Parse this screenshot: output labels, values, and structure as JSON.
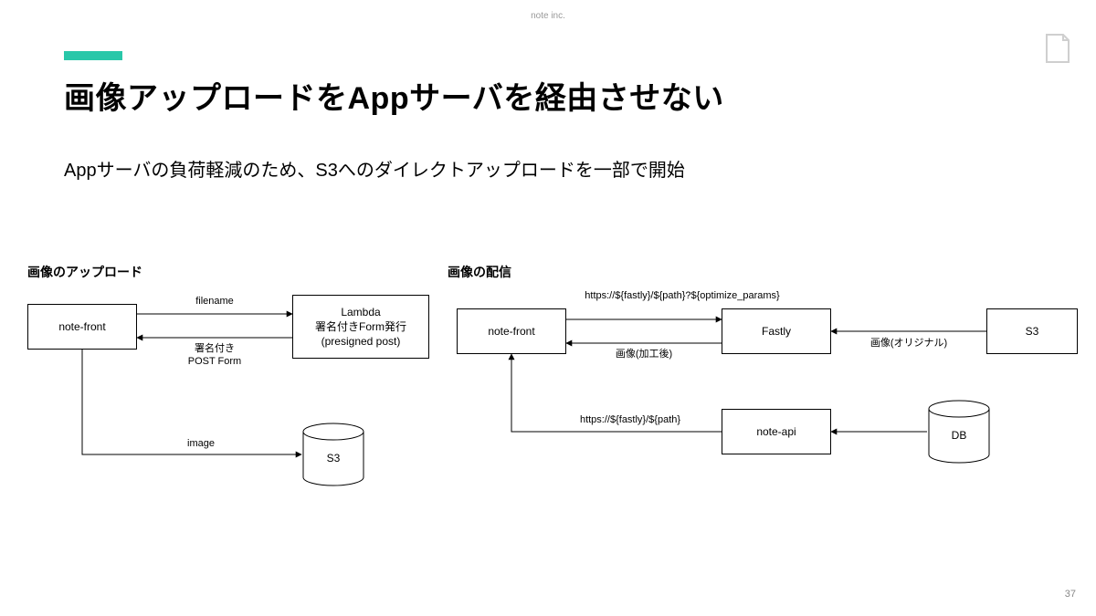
{
  "company": "note inc.",
  "title": "画像アップロードをAppサーバを経由させない",
  "subtitle": "Appサーバの負荷軽減のため、S3へのダイレクトアップロードを一部で開始",
  "page_number": "37",
  "diagrams": {
    "upload": {
      "title": "画像のアップロード",
      "nodes": {
        "note_front": "note-front",
        "lambda": "Lambda\n署名付きForm発行\n(presigned post)",
        "s3": "S3"
      },
      "edges": {
        "filename": "filename",
        "signed_form": "署名付き\nPOST Form",
        "image": "image"
      }
    },
    "delivery": {
      "title": "画像の配信",
      "nodes": {
        "note_front": "note-front",
        "fastly": "Fastly",
        "s3": "S3",
        "note_api": "note-api",
        "db": "DB"
      },
      "edges": {
        "req_opt": "https://${fastly}/${path}?${optimize_params}",
        "img_processed": "画像(加工後)",
        "img_original": "画像(オリジナル)",
        "req_path": "https://${fastly}/${path}"
      }
    }
  }
}
